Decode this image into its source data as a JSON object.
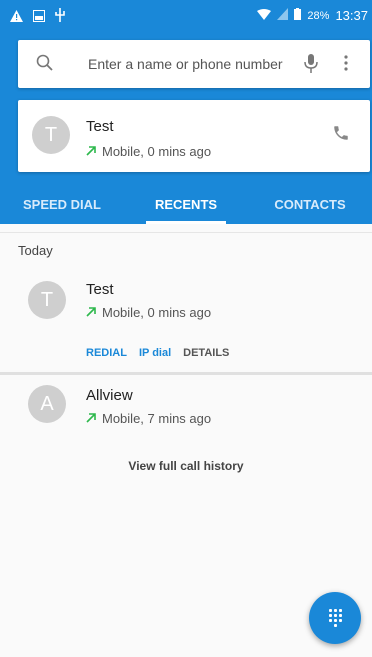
{
  "status_bar": {
    "icons": [
      "alert-triangle-icon",
      "image-icon",
      "usb-icon",
      "wifi-icon",
      "no-sim-icon",
      "battery-icon"
    ],
    "battery_percent": "28%",
    "time": "13:37"
  },
  "search": {
    "placeholder": "Enter a name or phone number"
  },
  "recent_card": {
    "avatar_letter": "T",
    "name": "Test",
    "call_info": "Mobile, 0 mins ago"
  },
  "tabs": [
    {
      "label": "SPEED DIAL",
      "active": false
    },
    {
      "label": "RECENTS",
      "active": true
    },
    {
      "label": "CONTACTS",
      "active": false
    }
  ],
  "section": {
    "label": "Today"
  },
  "recents": [
    {
      "avatar_letter": "T",
      "name": "Test",
      "call_info": "Mobile, 0 mins ago",
      "actions": [
        "REDIAL",
        "IP dial",
        "DETAILS"
      ]
    },
    {
      "avatar_letter": "A",
      "name": "Allview",
      "call_info": "Mobile, 7 mins ago"
    }
  ],
  "history_link": "View full call history",
  "colors": {
    "accent": "#1a88d8",
    "outgoing_arrow": "#2db84c",
    "avatar_gray": "#cfcfcf"
  }
}
